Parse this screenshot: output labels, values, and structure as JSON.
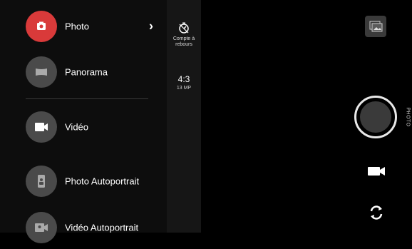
{
  "modes": [
    {
      "label": "Photo",
      "icon": "camera-icon",
      "active": true,
      "has_chevron": true
    },
    {
      "label": "Panorama",
      "icon": "panorama-icon",
      "active": false
    },
    {
      "label": "Vidéo",
      "icon": "video-icon",
      "active": false
    },
    {
      "label": "Photo Autoportrait",
      "icon": "selfie-photo-icon",
      "active": false
    },
    {
      "label": "Vidéo Autoportrait",
      "icon": "selfie-video-icon",
      "active": false
    }
  ],
  "settings": {
    "timer_label_line1": "Compte à",
    "timer_label_line2": "rebours",
    "aspect_ratio": "4:3",
    "resolution": "13 MP"
  },
  "right_panel": {
    "mode_label": "PHOTO"
  },
  "colors": {
    "active_mode": "#d93a3a",
    "inactive_mode": "#4a4a4a",
    "background": "#000000"
  }
}
